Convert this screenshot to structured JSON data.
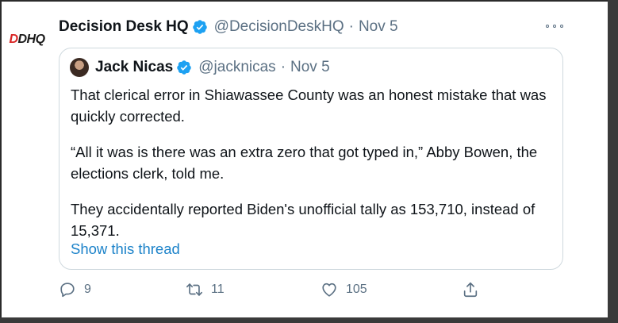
{
  "tweet": {
    "author_name": "Decision Desk HQ",
    "author_handle": "@DecisionDeskHQ",
    "separator": "·",
    "date": "Nov 5",
    "avatar_text_a": "D",
    "avatar_text_b": "DHQ"
  },
  "quoted": {
    "author_name": "Jack Nicas",
    "author_handle": "@jacknicas",
    "separator": "·",
    "date": "Nov 5",
    "paragraphs": [
      "That clerical error in Shiawassee County was an honest mistake that was quickly corrected.",
      "“All it was is there was an extra zero that got typed in,” Abby Bowen, the elections clerk, told me.",
      "They accidentally reported Biden's unofficial tally as 153,710, instead of 15,371."
    ],
    "show_thread": "Show this thread"
  },
  "actions": {
    "reply_count": "9",
    "retweet_count": "11",
    "like_count": "105"
  },
  "colors": {
    "verified": "#1da1f2",
    "link": "#1b82c9",
    "muted": "#5b7083"
  },
  "icons": [
    "verified-badge-icon",
    "more-icon",
    "reply-icon",
    "retweet-icon",
    "like-icon",
    "share-icon"
  ]
}
